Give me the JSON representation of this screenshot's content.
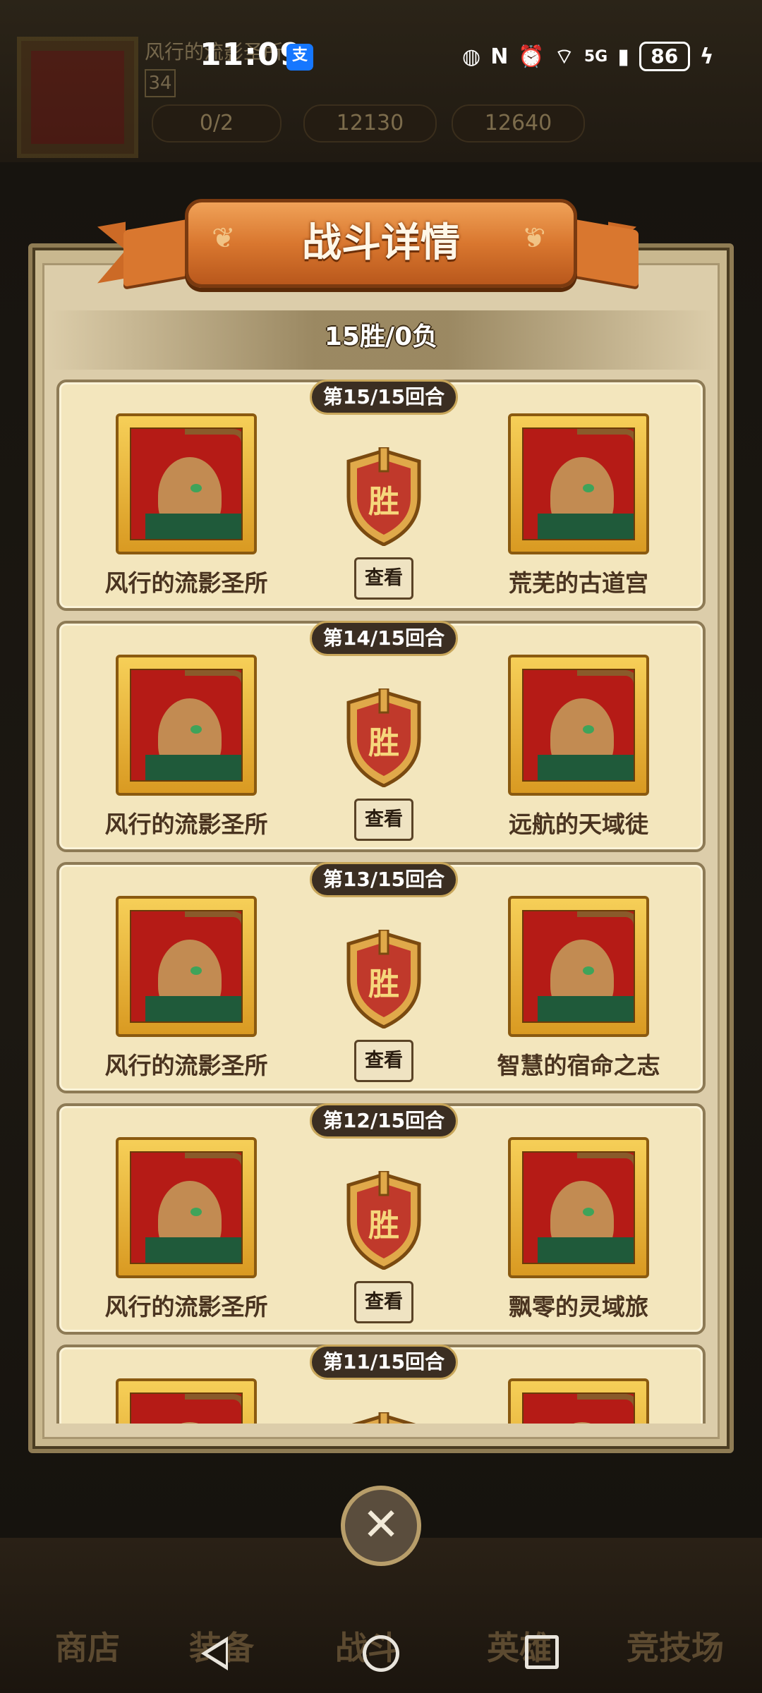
{
  "status_bar": {
    "time": "11:09",
    "app_icon": "支",
    "network": "5G",
    "battery": "86"
  },
  "background": {
    "player_name": "风行的流影圣所",
    "level": "34",
    "stat_1": "0/2",
    "stat_2": "12130",
    "stat_3": "12640",
    "nav": [
      "商店",
      "装备",
      "战斗",
      "英雄",
      "竞技场"
    ]
  },
  "dialog": {
    "title": "战斗详情",
    "summary": "15胜/0负",
    "rounds": [
      {
        "round": "第15/15回合",
        "left": "风行的流影圣所",
        "right": "荒芜的古道宫",
        "result": "胜",
        "view": "查看"
      },
      {
        "round": "第14/15回合",
        "left": "风行的流影圣所",
        "right": "远航的天域徒",
        "result": "胜",
        "view": "查看"
      },
      {
        "round": "第13/15回合",
        "left": "风行的流影圣所",
        "right": "智慧的宿命之志",
        "result": "胜",
        "view": "查看"
      },
      {
        "round": "第12/15回合",
        "left": "风行的流影圣所",
        "right": "飘零的灵域旅",
        "result": "胜",
        "view": "查看"
      },
      {
        "round": "第11/15回合",
        "left": "",
        "right": "",
        "result": "",
        "view": ""
      }
    ],
    "close_symbol": "✕"
  },
  "colors": {
    "banner": "#d9772f",
    "card": "#f3e6bd",
    "shield": "#c0392b"
  }
}
